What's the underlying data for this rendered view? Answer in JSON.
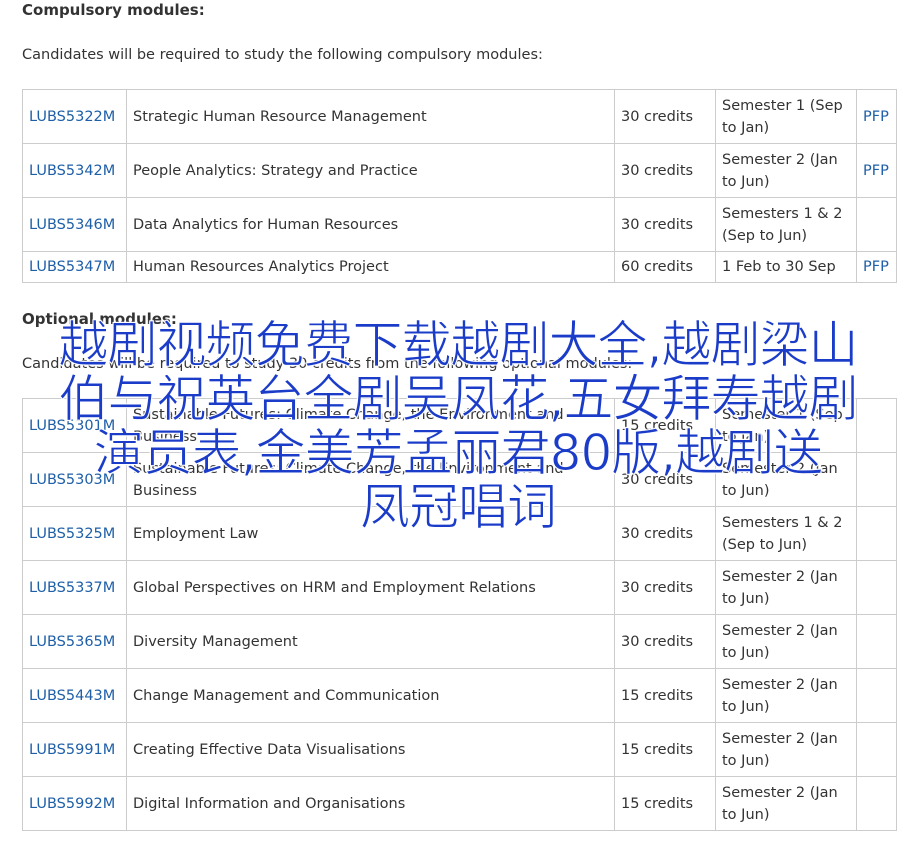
{
  "compulsory": {
    "heading": "Compulsory modules:",
    "intro": "Candidates will be required to study the following compulsory modules:",
    "rows": [
      {
        "code": "LUBS5322M",
        "title": "Strategic Human Resource Management",
        "credits": "30 credits",
        "semester": "Semester 1 (Sep to Jan)",
        "pfp": "PFP"
      },
      {
        "code": "LUBS5342M",
        "title": "People Analytics: Strategy and Practice",
        "credits": "30 credits",
        "semester": "Semester 2 (Jan to Jun)",
        "pfp": "PFP"
      },
      {
        "code": "LUBS5346M",
        "title": "Data Analytics for Human Resources",
        "credits": "30 credits",
        "semester": "Semesters 1 & 2 (Sep to Jun)",
        "pfp": ""
      },
      {
        "code": "LUBS5347M",
        "title": "Human Resources Analytics Project",
        "credits": "60 credits",
        "semester": "1 Feb to 30 Sep",
        "pfp": "PFP"
      }
    ]
  },
  "optional": {
    "heading": "Optional modules:",
    "intro": "Candidates will be required to study 30 credits from the following optional modules:",
    "rows": [
      {
        "code": "LUBS5301M",
        "title": "Sustainable Futures: Climate Change, the Environment and Business",
        "credits": "15 credits",
        "semester": "Semester 1 (Sep to Jan)",
        "pfp": ""
      },
      {
        "code": "LUBS5303M",
        "title": "Sustainable Futures: Climate Change, the Environment and Business",
        "credits": "30 credits",
        "semester": "Semester 2 (Jan to Jun)",
        "pfp": ""
      },
      {
        "code": "LUBS5325M",
        "title": "Employment Law",
        "credits": "30 credits",
        "semester": "Semesters 1 & 2 (Sep to Jun)",
        "pfp": ""
      },
      {
        "code": "LUBS5337M",
        "title": "Global Perspectives on HRM and Employment Relations",
        "credits": "30 credits",
        "semester": "Semester 2 (Jan to Jun)",
        "pfp": ""
      },
      {
        "code": "LUBS5365M",
        "title": "Diversity Management",
        "credits": "30 credits",
        "semester": "Semester 2 (Jan to Jun)",
        "pfp": ""
      },
      {
        "code": "LUBS5443M",
        "title": "Change Management and Communication",
        "credits": "15 credits",
        "semester": "Semester 2 (Jan to Jun)",
        "pfp": ""
      },
      {
        "code": "LUBS5991M",
        "title": "Creating Effective Data Visualisations",
        "credits": "15 credits",
        "semester": "Semester 2 (Jan to Jun)",
        "pfp": ""
      },
      {
        "code": "LUBS5992M",
        "title": "Digital Information and Organisations",
        "credits": "15 credits",
        "semester": "Semester 2 (Jan to Jun)",
        "pfp": ""
      }
    ]
  },
  "overlay": {
    "lines": [
      "越剧视频免费下载越剧大全,越剧梁山",
      "伯与祝英台全剧吴凤花,五女拜寿越剧",
      "演员表,金美芳孟丽君80版,越剧送",
      "凤冠唱词"
    ]
  },
  "colors": {
    "link": "#1e5fa8",
    "overlay_text": "#1a3cc8",
    "border": "#cccccc",
    "text": "#333333"
  }
}
